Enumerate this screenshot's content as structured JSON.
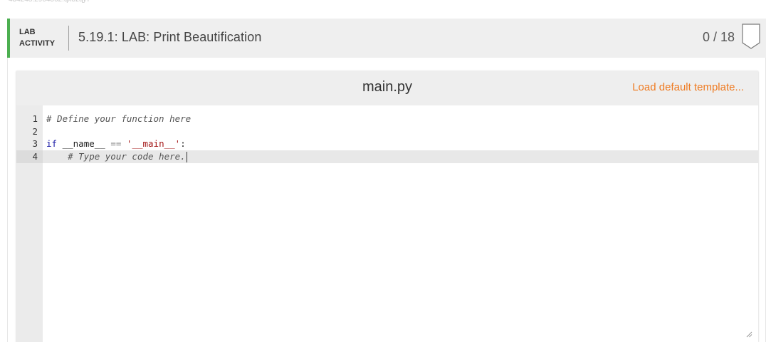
{
  "top_id": "434248.2964362.qx3zqy7",
  "lab": {
    "tag_line1": "LAB",
    "tag_line2": "ACTIVITY",
    "title": "5.19.1: LAB: Print Beautification",
    "score": "0 / 18",
    "accent_color": "#4caf50",
    "badge_icon": "shield-badge-icon"
  },
  "editor": {
    "file_name": "main.py",
    "load_default_label": "Load default template...",
    "link_color": "#ef7b22",
    "lines": [
      {
        "number": "1",
        "code": "# Define your function here"
      },
      {
        "number": "2",
        "code": ""
      },
      {
        "number": "3",
        "kw": "if",
        "name": " __name__ ",
        "op": "==",
        "str": " '__main__'",
        "rest": ":"
      },
      {
        "number": "4",
        "code": "    # Type your code here."
      }
    ]
  }
}
